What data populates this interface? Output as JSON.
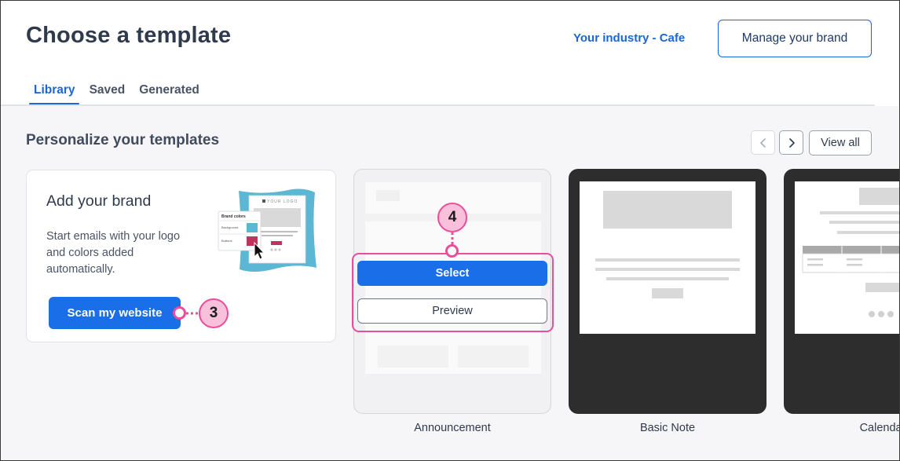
{
  "header": {
    "title": "Choose a template",
    "industry_link": "Your industry - Cafe",
    "manage_brand_button": "Manage your brand"
  },
  "tabs": [
    {
      "label": "Library",
      "active": true
    },
    {
      "label": "Saved",
      "active": false
    },
    {
      "label": "Generated",
      "active": false
    }
  ],
  "section": {
    "title": "Personalize your templates",
    "view_all_button": "View all"
  },
  "brand_card": {
    "title": "Add your brand",
    "description_lines": [
      "Start emails with your logo",
      "and colors added",
      "automatically."
    ],
    "scan_button": "Scan my website",
    "illustration": {
      "logo_text": "YOUR LOGO",
      "popover_title": "Brand colors",
      "popover_rows": [
        "Background",
        "Buttons"
      ]
    }
  },
  "templates": [
    {
      "name": "Announcement",
      "select_button": "Select",
      "preview_button": "Preview"
    },
    {
      "name": "Basic Note"
    },
    {
      "name": "Calendar"
    }
  ],
  "callouts": [
    {
      "number": "3"
    },
    {
      "number": "4"
    }
  ],
  "colors": {
    "accent": "#1a6ee8",
    "link": "#1a66d6",
    "callout": "#e84e9a",
    "callout_fill": "#f9c0dc",
    "dark_card": "#2d2d2d"
  }
}
